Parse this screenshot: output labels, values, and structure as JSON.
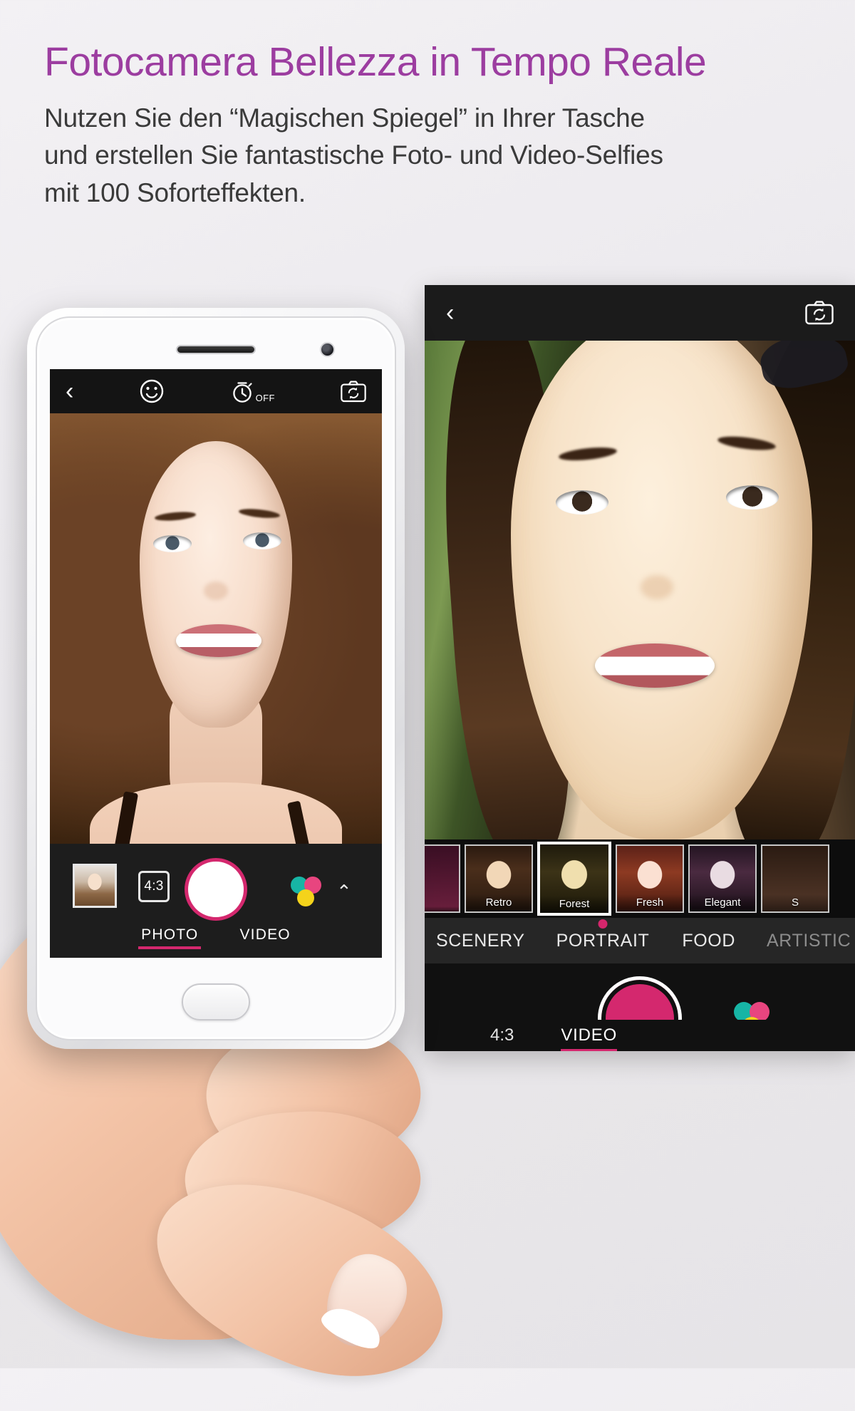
{
  "header": {
    "title": "Fotocamera Bellezza in Tempo Reale",
    "subtitle_lines": [
      "Nutzen Sie den “Magischen Spiegel” in Ihrer Tasche",
      "und erstellen Sie fantastische Foto- und Video-Selfies",
      " mit 100 Soforteffekten."
    ],
    "title_color": "#9c3da0",
    "subtitle_color": "#3a3a3a"
  },
  "front_phone": {
    "topbar": {
      "back_label": "‹",
      "beauty_icon": "smiley-face-icon",
      "timer_label": "OFF",
      "switch_camera_icon": "switch-camera-icon"
    },
    "bottombar": {
      "gallery_thumb": "gallery-thumbnail",
      "ratio_label": "4:3",
      "shutter_label": "",
      "effects_icon": "color-wheel-icon",
      "expand_icon": "chevron-up-icon",
      "modes": [
        {
          "label": "PHOTO",
          "active": true
        },
        {
          "label": "VIDEO",
          "active": false
        }
      ]
    }
  },
  "back_phone": {
    "topbar": {
      "back_label": "‹",
      "switch_camera_icon": "switch-camera-icon"
    },
    "filters": [
      {
        "label": "",
        "selected": false
      },
      {
        "label": "Retro",
        "selected": false
      },
      {
        "label": "Forest",
        "selected": true
      },
      {
        "label": "Fresh",
        "selected": false
      },
      {
        "label": "Elegant",
        "selected": false
      },
      {
        "label": "S",
        "selected": false
      }
    ],
    "categories": [
      {
        "label": "SCENERY",
        "active": false
      },
      {
        "label": "PORTRAIT",
        "active": true
      },
      {
        "label": "FOOD",
        "active": false
      },
      {
        "label": "ARTISTIC",
        "active": false,
        "dimmed": true
      }
    ],
    "controls": {
      "ratio_label": "4:3",
      "shutter_color": "#d4286e",
      "effects_icon": "color-wheel-icon",
      "expand_icon": "chevron-down-icon",
      "modes": [
        {
          "label": "VIDEO",
          "active": true
        }
      ]
    }
  },
  "colors": {
    "accent_pink": "#d4286e",
    "purple": "#9c3da0",
    "wheel_teal": "#17b5a5",
    "wheel_pink": "#e8457f",
    "wheel_yellow": "#f4d31b"
  }
}
